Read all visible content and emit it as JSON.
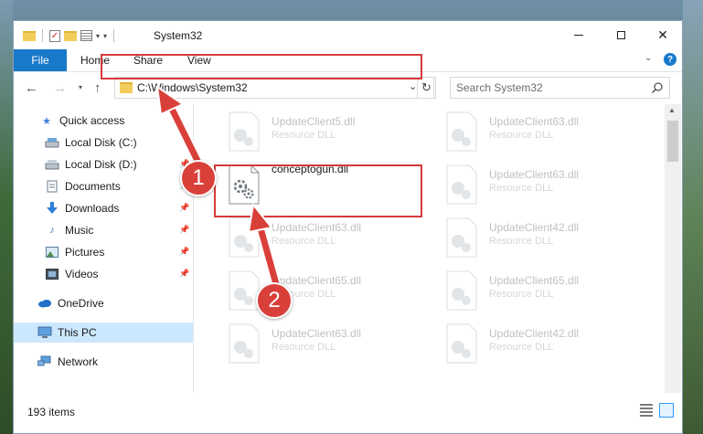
{
  "window": {
    "title": "System32"
  },
  "ribbon": {
    "tabs": [
      "File",
      "Home",
      "Share",
      "View"
    ]
  },
  "navbar": {
    "address": "C:\\Windows\\System32",
    "search_placeholder": "Search System32"
  },
  "sidebar": {
    "items": [
      {
        "label": "Quick access",
        "icon": "star-icon"
      },
      {
        "label": "Local Disk (C:)",
        "icon": "drive-icon"
      },
      {
        "label": "Local Disk (D:)",
        "icon": "drive-icon"
      },
      {
        "label": "Documents",
        "icon": "documents-icon"
      },
      {
        "label": "Downloads",
        "icon": "download-icon"
      },
      {
        "label": "Music",
        "icon": "music-icon"
      },
      {
        "label": "Pictures",
        "icon": "pictures-icon"
      },
      {
        "label": "Videos",
        "icon": "videos-icon"
      },
      {
        "label": "OneDrive",
        "icon": "cloud-icon"
      },
      {
        "label": "This PC",
        "icon": "computer-icon"
      },
      {
        "label": "Network",
        "icon": "network-icon"
      }
    ]
  },
  "files": [
    {
      "name": "UpdateClient5.dll",
      "type": "Resource DLL"
    },
    {
      "name": "UpdateClient63.dll",
      "type": "Resource DLL"
    },
    {
      "name": "conceptogun.dll",
      "type": ""
    },
    {
      "name": "UpdateClient63.dll",
      "type": "Resource DLL"
    },
    {
      "name": "UpdateClient63.dll",
      "type": "Resource DLL"
    },
    {
      "name": "UpdateClient42.dll",
      "type": "Resource DLL"
    },
    {
      "name": "UpdateClient65.dll",
      "type": "Resource DLL"
    },
    {
      "name": "UpdateClient65.dll",
      "type": "Resource DLL"
    },
    {
      "name": "UpdateClient63.dll",
      "type": "Resource DLL"
    },
    {
      "name": "UpdateClient42.dll",
      "type": "Resource DLL"
    }
  ],
  "status": {
    "item_count": "193 items"
  },
  "callouts": [
    "1",
    "2"
  ],
  "colors": {
    "accent": "#1979ca",
    "highlight": "#d63a3a",
    "selected": "#cce8ff"
  }
}
